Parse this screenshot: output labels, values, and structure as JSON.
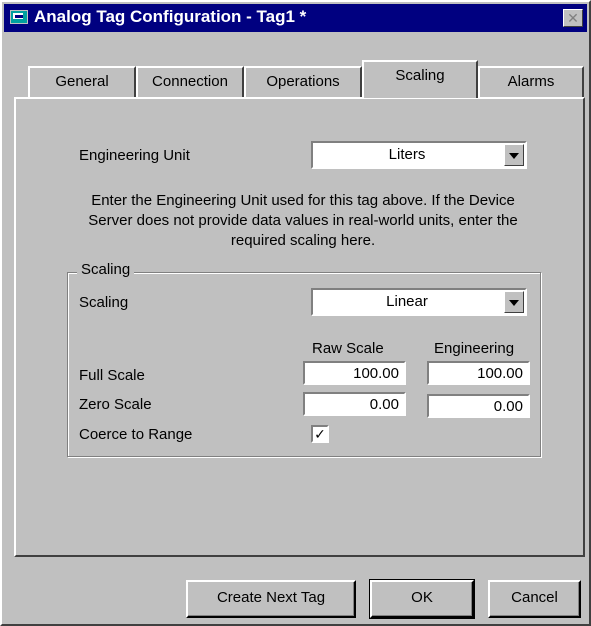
{
  "window": {
    "title": "Analog Tag Configuration - Tag1 *",
    "close_glyph": "✕"
  },
  "tabs": [
    {
      "label": "General",
      "active": false
    },
    {
      "label": "Connection",
      "active": false
    },
    {
      "label": "Operations",
      "active": false
    },
    {
      "label": "Scaling",
      "active": true
    },
    {
      "label": "Alarms",
      "active": false
    }
  ],
  "engineering_unit": {
    "label": "Engineering Unit",
    "value": "Liters"
  },
  "description": "Enter the Engineering Unit used for this tag above.  If the Device Server does not provide data values in real-world units, enter the required scaling here.",
  "scaling_group": {
    "title": "Scaling",
    "scaling_label": "Scaling",
    "scaling_value": "Linear",
    "col_raw": "Raw Scale",
    "col_eng": "Engineering",
    "full_scale_label": "Full Scale",
    "full_scale_raw": "100.00",
    "full_scale_eng": "100.00",
    "zero_scale_label": "Zero Scale",
    "zero_scale_raw": "0.00",
    "zero_scale_eng": "0.00",
    "coerce_label": "Coerce to Range",
    "coerce_checked": true,
    "check_glyph": "✓"
  },
  "buttons": {
    "create_next": "Create Next Tag",
    "ok": "OK",
    "cancel": "Cancel"
  },
  "colors": {
    "titlebar": "#000080",
    "face": "#c0c0c0"
  },
  "icons": [
    "app-icon",
    "close-icon",
    "dropdown-arrow-icon",
    "checkmark-icon"
  ]
}
